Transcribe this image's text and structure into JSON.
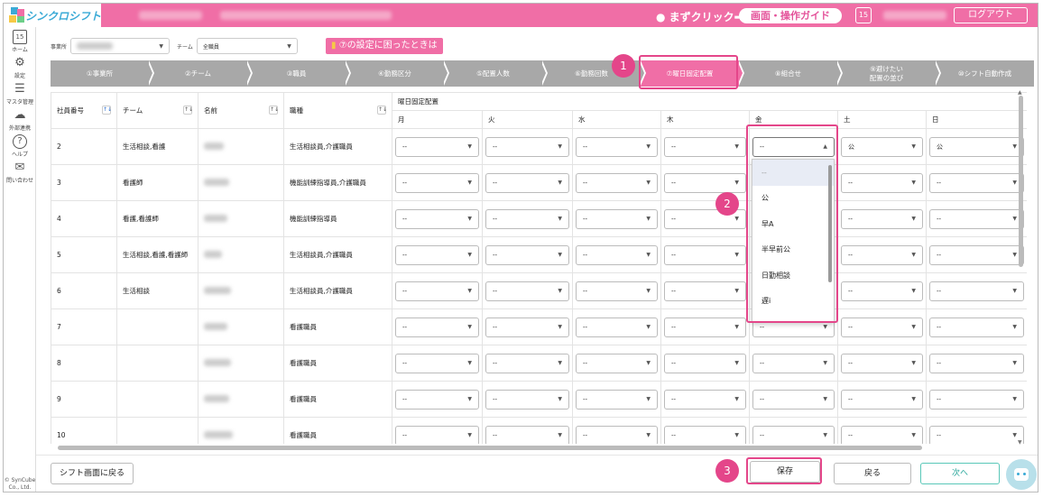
{
  "app": {
    "name": "シンクロシフト",
    "logout": "ログアウト",
    "cal_day": "15"
  },
  "guide": {
    "prompt": "● まずクリック➡",
    "button": "画面・操作ガイド"
  },
  "sidebar": {
    "items": [
      {
        "label": "ホーム",
        "icon": "calendar-icon",
        "glyph": "15"
      },
      {
        "label": "設定",
        "icon": "gear-icon",
        "glyph": "⚙"
      },
      {
        "label": "マスタ管理",
        "icon": "database-icon",
        "glyph": "☰"
      },
      {
        "label": "外部連携",
        "icon": "cloud-icon",
        "glyph": "☁"
      },
      {
        "label": "ヘルプ",
        "icon": "help-icon",
        "glyph": "?"
      },
      {
        "label": "問い合わせ",
        "icon": "mail-icon",
        "glyph": "✉"
      }
    ],
    "copyright": "© SynCube Co., Ltd."
  },
  "filter": {
    "office_label": "事業所",
    "team_label": "チーム",
    "team_value": "全職員",
    "help_tag": "⑦の設定に困ったときは"
  },
  "steps": [
    {
      "label": "①事業所"
    },
    {
      "label": "②チーム"
    },
    {
      "label": "③職員"
    },
    {
      "label": "④勤務区分"
    },
    {
      "label": "⑤配置人数"
    },
    {
      "label": "⑥勤務回数"
    },
    {
      "label": "⑦曜日固定配置"
    },
    {
      "label": "⑧組合せ"
    },
    {
      "label": "⑨避けたい\n配置の並び"
    },
    {
      "label": "⑩シフト自動作成"
    }
  ],
  "table": {
    "headers": {
      "id": "社員番号",
      "team": "チーム",
      "name": "名前",
      "job": "職種",
      "group": "曜日固定配置"
    },
    "days": [
      "月",
      "火",
      "水",
      "木",
      "金",
      "土",
      "日"
    ],
    "rows": [
      {
        "id": "2",
        "team": "生活相談,看護",
        "job": "生活相談員,介護職員",
        "vals": [
          "--",
          "--",
          "--",
          "--",
          "--",
          "公",
          "公"
        ]
      },
      {
        "id": "3",
        "team": "看護師",
        "job": "機能訓練指導員,介護職員",
        "vals": [
          "--",
          "--",
          "--",
          "--",
          "--",
          "--",
          "--"
        ]
      },
      {
        "id": "4",
        "team": "看護,看護師",
        "job": "機能訓練指導員",
        "vals": [
          "--",
          "--",
          "--",
          "--",
          "--",
          "--",
          "--"
        ]
      },
      {
        "id": "5",
        "team": "生活相談,看護,看護師",
        "job": "生活相談員,介護職員",
        "vals": [
          "--",
          "--",
          "--",
          "--",
          "--",
          "--",
          "--"
        ]
      },
      {
        "id": "6",
        "team": "生活相談",
        "job": "生活相談員,介護職員",
        "vals": [
          "--",
          "--",
          "--",
          "--",
          "--",
          "--",
          "--"
        ]
      },
      {
        "id": "7",
        "team": "",
        "job": "看護職員",
        "vals": [
          "--",
          "--",
          "--",
          "--",
          "--",
          "--",
          "--"
        ]
      },
      {
        "id": "8",
        "team": "",
        "job": "看護職員",
        "vals": [
          "--",
          "--",
          "--",
          "--",
          "--",
          "--",
          "--"
        ]
      },
      {
        "id": "9",
        "team": "",
        "job": "看護職員",
        "vals": [
          "--",
          "--",
          "--",
          "--",
          "--",
          "--",
          "--"
        ]
      },
      {
        "id": "10",
        "team": "",
        "job": "看護職員",
        "vals": [
          "--",
          "--",
          "--",
          "--",
          "--",
          "--",
          "--"
        ]
      }
    ]
  },
  "dropdown": {
    "options": [
      "--",
      "公",
      "早A",
      "半早前公",
      "日勤相談",
      "遅i"
    ]
  },
  "badges": [
    "1",
    "2",
    "3"
  ],
  "footer": {
    "back_to_shift": "シフト画面に戻る",
    "save": "保存",
    "back": "戻る",
    "next": "次へ"
  }
}
